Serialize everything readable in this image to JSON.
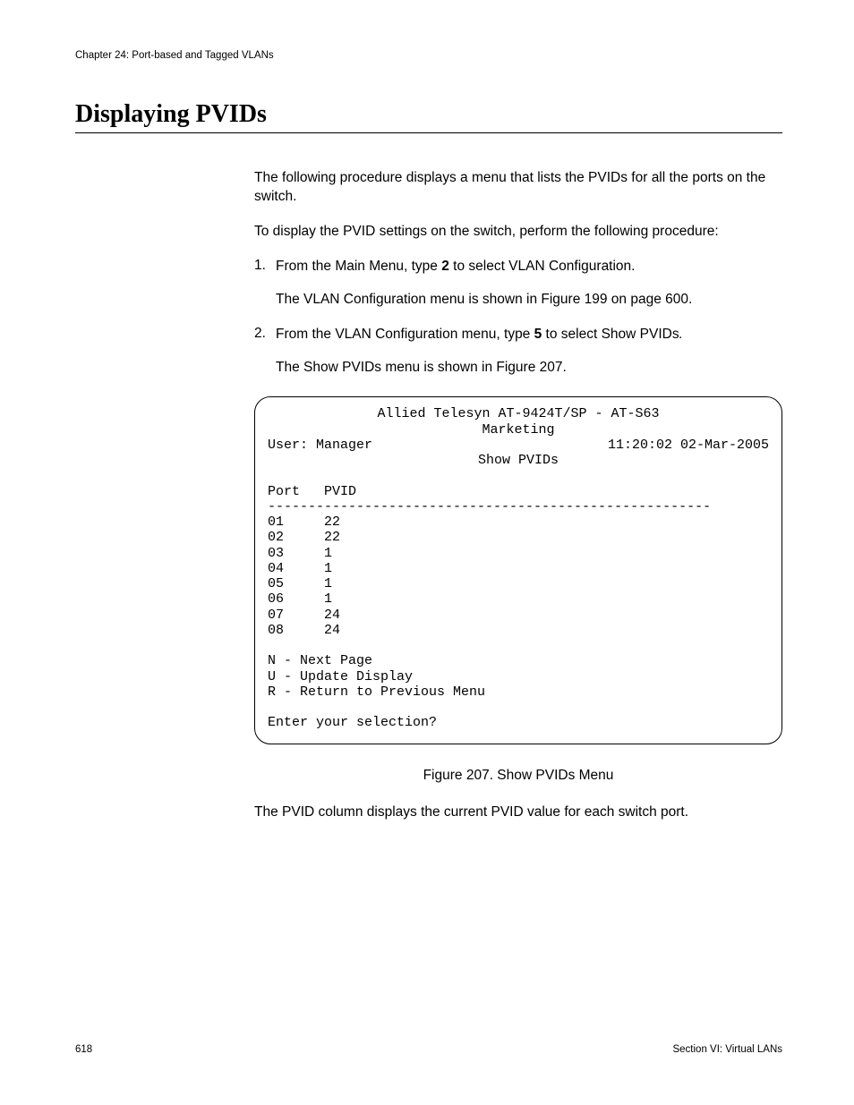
{
  "header": {
    "chapter": "Chapter 24: Port-based and Tagged VLANs"
  },
  "title": "Displaying PVIDs",
  "body": {
    "intro": "The following procedure displays a menu that lists the PVIDs for all the ports on the switch.",
    "lead": "To display the PVID settings on the switch, perform the following procedure:",
    "step1_pre": "From the Main Menu, type ",
    "step1_bold": "2",
    "step1_post": " to select VLAN Configuration.",
    "step1_sub": "The VLAN Configuration menu is shown in Figure 199 on page 600.",
    "step2_pre": "From the VLAN Configuration menu, type ",
    "step2_bold": "5",
    "step2_post_a": " to select Show PVIDs",
    "step2_post_b": ".",
    "step2_sub": "The Show PVIDs menu is shown in Figure 207.",
    "closing": "The PVID column displays the current PVID value for each switch port."
  },
  "terminal": {
    "line1": "Allied Telesyn AT-9424T/SP - AT-S63",
    "line2": "Marketing",
    "user": "User: Manager",
    "timestamp": "11:20:02 02-Mar-2005",
    "subtitle": "Show PVIDs",
    "col_header": "Port   PVID",
    "divider": "-------------------------------------------------------",
    "rows": [
      "01     22",
      "02     22",
      "03     1",
      "04     1",
      "05     1",
      "06     1",
      "07     24",
      "08     24"
    ],
    "opt_n": "N - Next Page",
    "opt_u": "U - Update Display",
    "opt_r": "R - Return to Previous Menu",
    "prompt": "Enter your selection?"
  },
  "figure_caption": "Figure 207. Show PVIDs Menu",
  "footer": {
    "page": "618",
    "section": "Section VI: Virtual LANs"
  }
}
